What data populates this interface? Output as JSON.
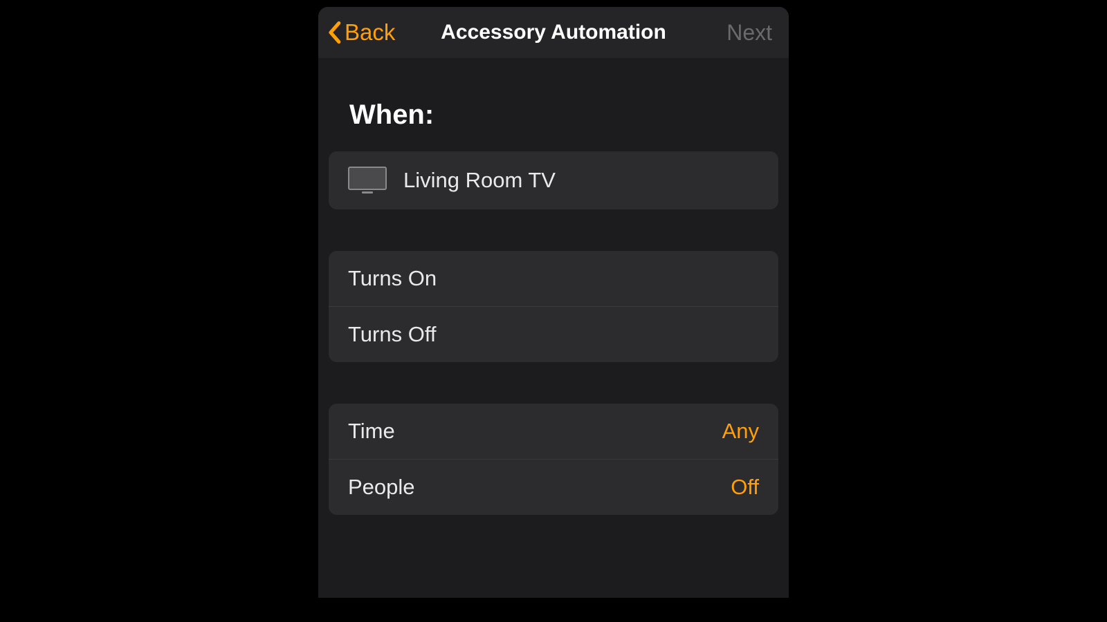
{
  "nav": {
    "back_label": "Back",
    "title": "Accessory Automation",
    "next_label": "Next"
  },
  "section": {
    "title": "When:"
  },
  "accessory": {
    "name": "Living Room TV",
    "icon": "tv-icon"
  },
  "triggers": {
    "on_label": "Turns On",
    "off_label": "Turns Off"
  },
  "conditions": {
    "time_label": "Time",
    "time_value": "Any",
    "people_label": "People",
    "people_value": "Off"
  },
  "colors": {
    "accent": "#ff9f0a"
  }
}
